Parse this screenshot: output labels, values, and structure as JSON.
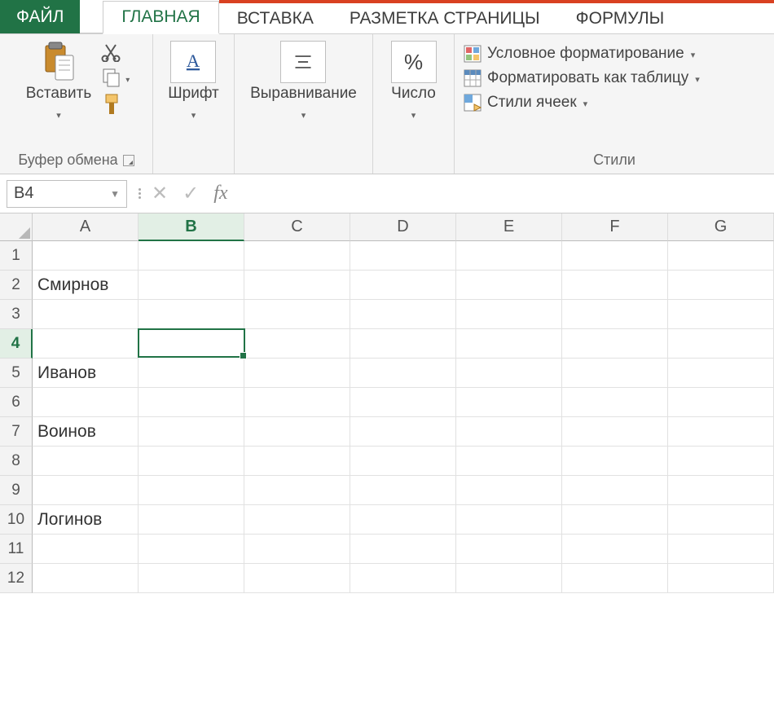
{
  "tabs": {
    "file": "ФАЙЛ",
    "home": "ГЛАВНАЯ",
    "insert": "ВСТАВКА",
    "layout": "РАЗМЕТКА СТРАНИЦЫ",
    "formulas": "ФОРМУЛЫ"
  },
  "ribbon": {
    "clipboard": {
      "paste": "Вставить",
      "group": "Буфер обмена"
    },
    "font": {
      "label": "Шрифт"
    },
    "align": {
      "label": "Выравнивание"
    },
    "number": {
      "symbol": "%",
      "label": "Число"
    },
    "styles": {
      "cond": "Условное форматирование",
      "table": "Форматировать как таблицу",
      "cell": "Стили ячеек",
      "group": "Стили"
    }
  },
  "formula_bar": {
    "namebox": "B4",
    "fx": "fx",
    "value": ""
  },
  "columns": [
    "A",
    "B",
    "C",
    "D",
    "E",
    "F",
    "G"
  ],
  "rows": [
    1,
    2,
    3,
    4,
    5,
    6,
    7,
    8,
    9,
    10,
    11,
    12
  ],
  "selected": {
    "row": 4,
    "col": "B"
  },
  "cells": {
    "A2": "Смирнов",
    "A5": "Иванов",
    "A7": "Воинов",
    "A10": "Логинов"
  }
}
